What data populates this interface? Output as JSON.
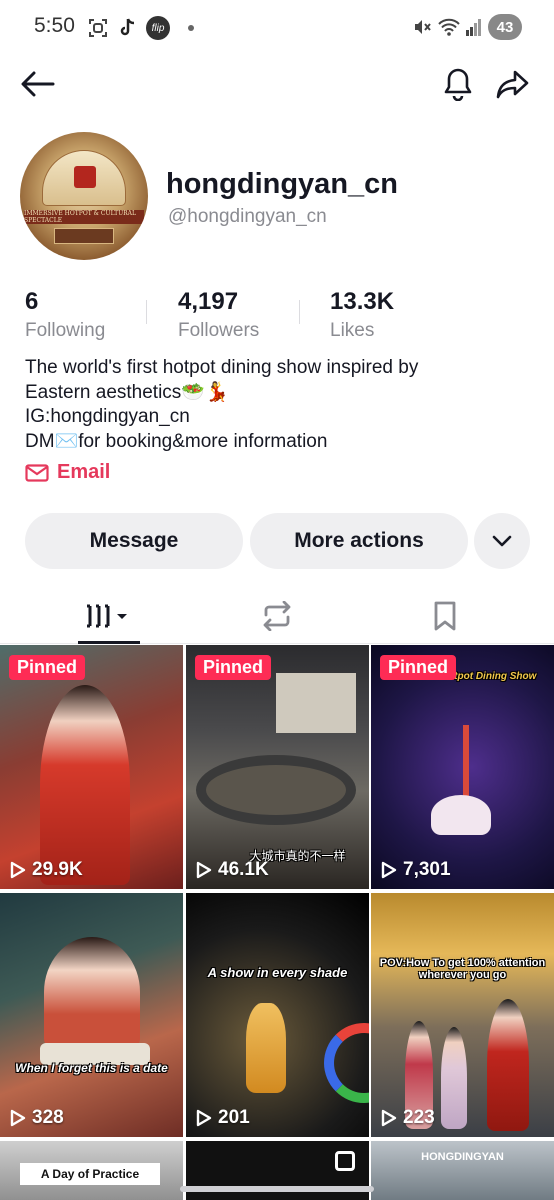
{
  "status_bar": {
    "time": "5:50",
    "flip_label": "flip",
    "battery": "43"
  },
  "profile": {
    "username": "hongdingyan_cn",
    "handle": "@hongdingyan_cn",
    "stats": [
      {
        "value": "6",
        "label": "Following"
      },
      {
        "value": "4,197",
        "label": "Followers"
      },
      {
        "value": "13.3K",
        "label": "Likes"
      }
    ],
    "bio": [
      "The world's first hotpot dining show inspired by",
      "Eastern aesthetics🥗💃",
      "IG:hongdingyan_cn",
      "DM✉️for booking&more information"
    ],
    "email_label": "Email",
    "avatar_text": "IMMERSIVE HOTPOT & CULTURAL SPECTACLE"
  },
  "actions": {
    "message": "Message",
    "more_actions": "More actions"
  },
  "tabs": [
    "videos-grid",
    "reposts",
    "saved"
  ],
  "videos": [
    {
      "pinned": "Pinned",
      "views": "29.9K",
      "caption": ""
    },
    {
      "pinned": "Pinned",
      "views": "46.1K",
      "caption": "大城市真的不一样"
    },
    {
      "pinned": "Pinned",
      "views": "7,301",
      "caption": "Immersive Hotpot Dining Show"
    },
    {
      "pinned": "",
      "views": "328",
      "caption": "When I forget this is a date"
    },
    {
      "pinned": "",
      "views": "201",
      "caption": "A show in every shade"
    },
    {
      "pinned": "",
      "views": "223",
      "caption": "POV:How To get 100% attention wherever you go"
    },
    {
      "pinned": "",
      "views": "",
      "caption": "A Day of Practice"
    },
    {
      "pinned": "",
      "views": "",
      "caption": ""
    },
    {
      "pinned": "",
      "views": "",
      "caption": "HONGDINGYAN"
    }
  ],
  "colors": {
    "accent": "#fe2c55",
    "email": "#e5395c",
    "muted": "#8a8b91"
  }
}
